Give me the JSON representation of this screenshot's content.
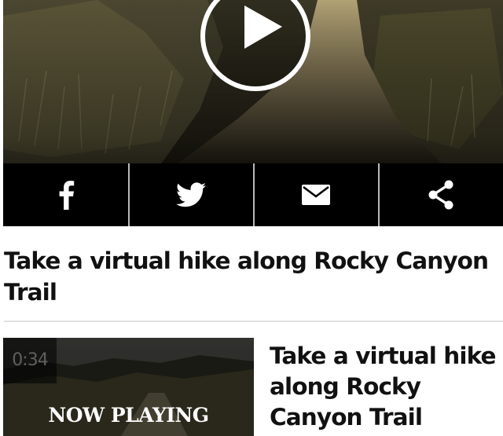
{
  "video": {
    "share": {
      "facebook_icon": "facebook-icon",
      "twitter_icon": "twitter-icon",
      "email_icon": "email-icon",
      "share_icon": "share-icon"
    },
    "play_icon": "play-icon"
  },
  "headline": "Take a virtual hike along Rocky Canyon Trail",
  "related": [
    {
      "duration": "0:34",
      "badge": "NOW PLAYING",
      "title": "Take a virtual hike along Rocky Canyon Trail"
    }
  ],
  "colors": {
    "share_bar": "#000000",
    "divider": "#e1e1e1",
    "text": "#111111"
  }
}
